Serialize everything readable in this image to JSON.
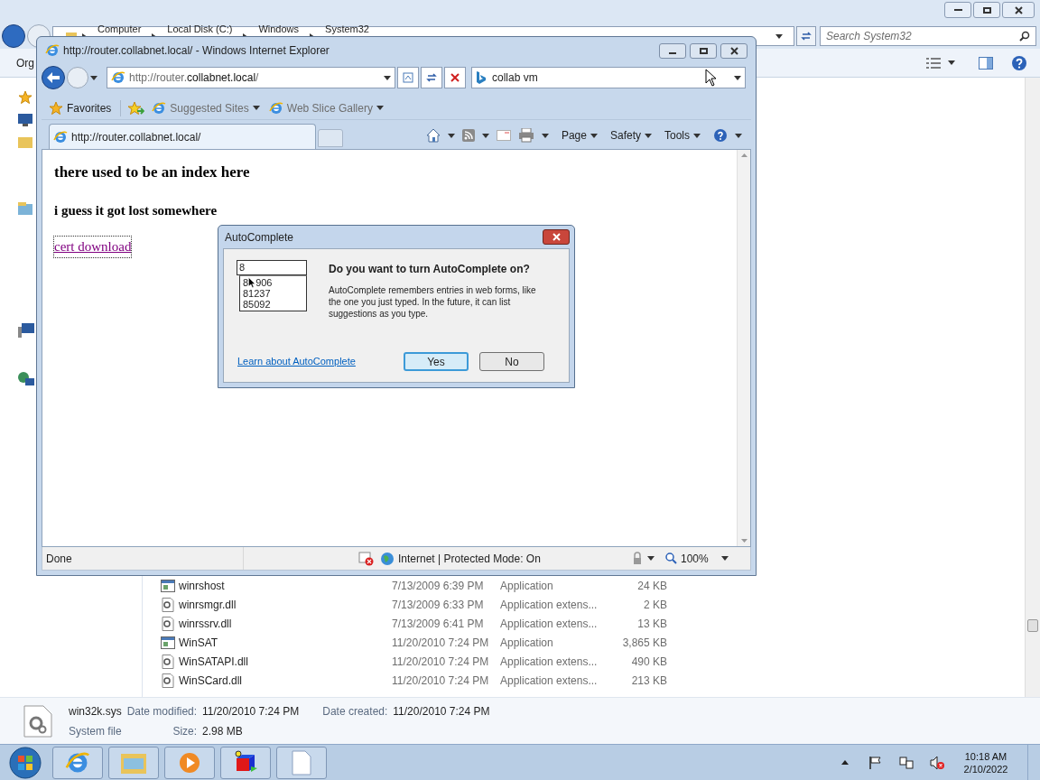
{
  "explorer": {
    "breadcrumb": [
      "Computer",
      "Local Disk (C:)",
      "Windows",
      "System32"
    ],
    "search": {
      "placeholder": "Search System32"
    },
    "toolbar_label": "Org",
    "files": [
      {
        "name": "winrshost",
        "date": "7/13/2009 6:39 PM",
        "type": "Application",
        "size": "24 KB",
        "kind": "app"
      },
      {
        "name": "winrsmgr.dll",
        "date": "7/13/2009 6:33 PM",
        "type": "Application extens...",
        "size": "2 KB",
        "kind": "dll"
      },
      {
        "name": "winrssrv.dll",
        "date": "7/13/2009 6:41 PM",
        "type": "Application extens...",
        "size": "13 KB",
        "kind": "dll"
      },
      {
        "name": "WinSAT",
        "date": "11/20/2010 7:24 PM",
        "type": "Application",
        "size": "3,865 KB",
        "kind": "app"
      },
      {
        "name": "WinSATAPI.dll",
        "date": "11/20/2010 7:24 PM",
        "type": "Application extens...",
        "size": "490 KB",
        "kind": "dll"
      },
      {
        "name": "WinSCard.dll",
        "date": "11/20/2010 7:24 PM",
        "type": "Application extens...",
        "size": "213 KB",
        "kind": "dll"
      }
    ],
    "details": {
      "file_name": "win32k.sys",
      "file_type": "System file",
      "date_modified_label": "Date modified:",
      "date_modified": "11/20/2010 7:24 PM",
      "size_label": "Size:",
      "size": "2.98 MB",
      "date_created_label": "Date created:",
      "date_created": "11/20/2010 7:24 PM"
    }
  },
  "browser": {
    "window": {
      "title": "http://router.collabnet.local/ - Windows Internet Explorer"
    },
    "address": {
      "prefix": "http://router.",
      "domain": "collabnet.local",
      "suffix": "/"
    },
    "search": {
      "value": "collab vm"
    },
    "favorites_bar": {
      "favorites": "Favorites",
      "links": [
        "Suggested Sites",
        "Web Slice Gallery"
      ]
    },
    "tabs": [
      {
        "label": "http://router.collabnet.local/",
        "selected": true
      }
    ],
    "command_bar": [
      "Page",
      "Safety",
      "Tools"
    ],
    "page": {
      "heading": "there used to be an index here",
      "subheading": "i guess it got lost somewhere",
      "link": "cert download"
    },
    "status_bar": {
      "text": "Done",
      "zone": "Internet | Protected Mode: On",
      "zoom": "100%"
    }
  },
  "dialog": {
    "title": "AutoComplete",
    "field_value": "8",
    "suggestions": [
      {
        "parts": [
          "8",
          "906"
        ]
      },
      {
        "parts": [
          "81237"
        ]
      },
      {
        "parts": [
          "85092"
        ]
      }
    ],
    "question": "Do you want to turn AutoComplete on?",
    "body": "AutoComplete remembers entries in web forms, like the one you just typed. In the future, it can list suggestions as you type.",
    "link": "Learn about AutoComplete",
    "buttons": [
      {
        "label": "Yes",
        "default": true
      },
      {
        "label": "No",
        "default": false
      }
    ]
  },
  "taskbar": {
    "items": [
      {
        "kind": "browser"
      },
      {
        "kind": "folder"
      },
      {
        "kind": "media"
      },
      {
        "kind": "cube"
      },
      {
        "kind": "document"
      }
    ],
    "clock": {
      "time": "10:18 AM",
      "date": "2/10/2022"
    }
  }
}
